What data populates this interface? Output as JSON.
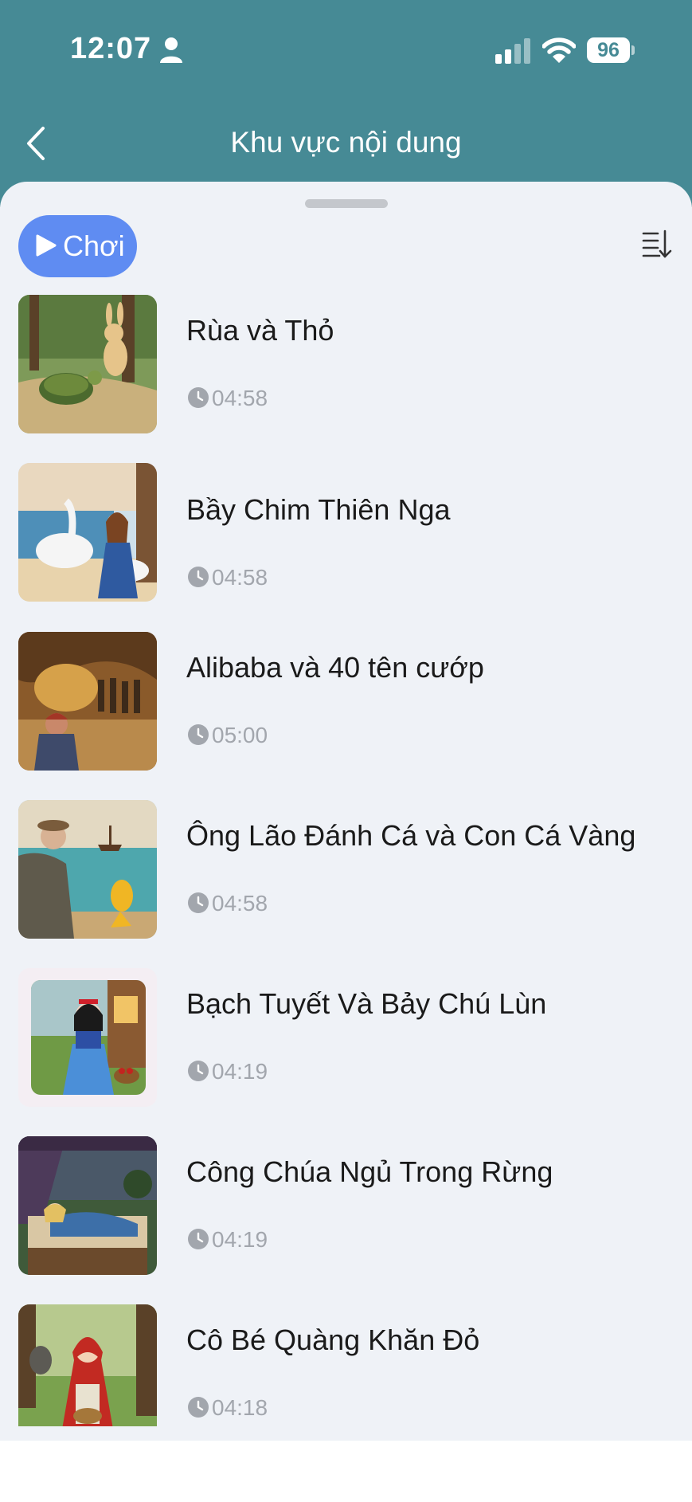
{
  "status_bar": {
    "time": "12:07",
    "battery": "96"
  },
  "header": {
    "title": "Khu vực nội dung"
  },
  "toolbar": {
    "play_label": "Chơi"
  },
  "items": [
    {
      "title": "Rùa và Thỏ",
      "duration": "04:58",
      "thumbnail": "tortoise-hare-image"
    },
    {
      "title": "Bầy Chim Thiên Nga",
      "duration": "04:58",
      "thumbnail": "swans-girl-image"
    },
    {
      "title": "Alibaba và 40 tên cướp",
      "duration": "05:00",
      "thumbnail": "cave-treasure-image"
    },
    {
      "title": "Ông Lão Đánh Cá và Con Cá Vàng",
      "duration": "04:58",
      "thumbnail": "fisherman-goldfish-image"
    },
    {
      "title": "Bạch Tuyết Và Bảy Chú Lùn",
      "duration": "04:19",
      "thumbnail": "snow-white-image"
    },
    {
      "title": "Công Chúa Ngủ Trong Rừng",
      "duration": "04:19",
      "thumbnail": "sleeping-princess-image"
    },
    {
      "title": "Cô Bé Quàng Khăn Đỏ",
      "duration": "04:18",
      "thumbnail": "red-riding-hood-image"
    }
  ],
  "colors": {
    "header_bg": "#468a95",
    "sheet_bg": "#eff2f7",
    "play_button": "#5f8cf2",
    "duration_text": "#a2a6ad"
  }
}
